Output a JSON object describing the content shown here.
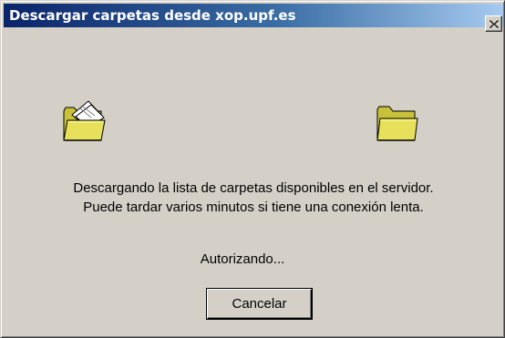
{
  "window": {
    "title": "Descargar carpetas desde xop.upf.es",
    "close_icon": "close-icon"
  },
  "animation": {
    "left_icon": "folder-with-paper-icon",
    "right_icon": "folder-icon"
  },
  "message": {
    "line1": "Descargando la lista de carpetas disponibles en el servidor.",
    "line2": "Puede tardar varios minutos si tiene una conexión lenta."
  },
  "status": "Autorizando...",
  "buttons": {
    "cancel_label": "Cancelar"
  },
  "colors": {
    "titlebar_start": "#0a246a",
    "titlebar_end": "#a6caf0",
    "dialog_face": "#d4d0c8",
    "folder_yellow": "#e6e05a"
  }
}
